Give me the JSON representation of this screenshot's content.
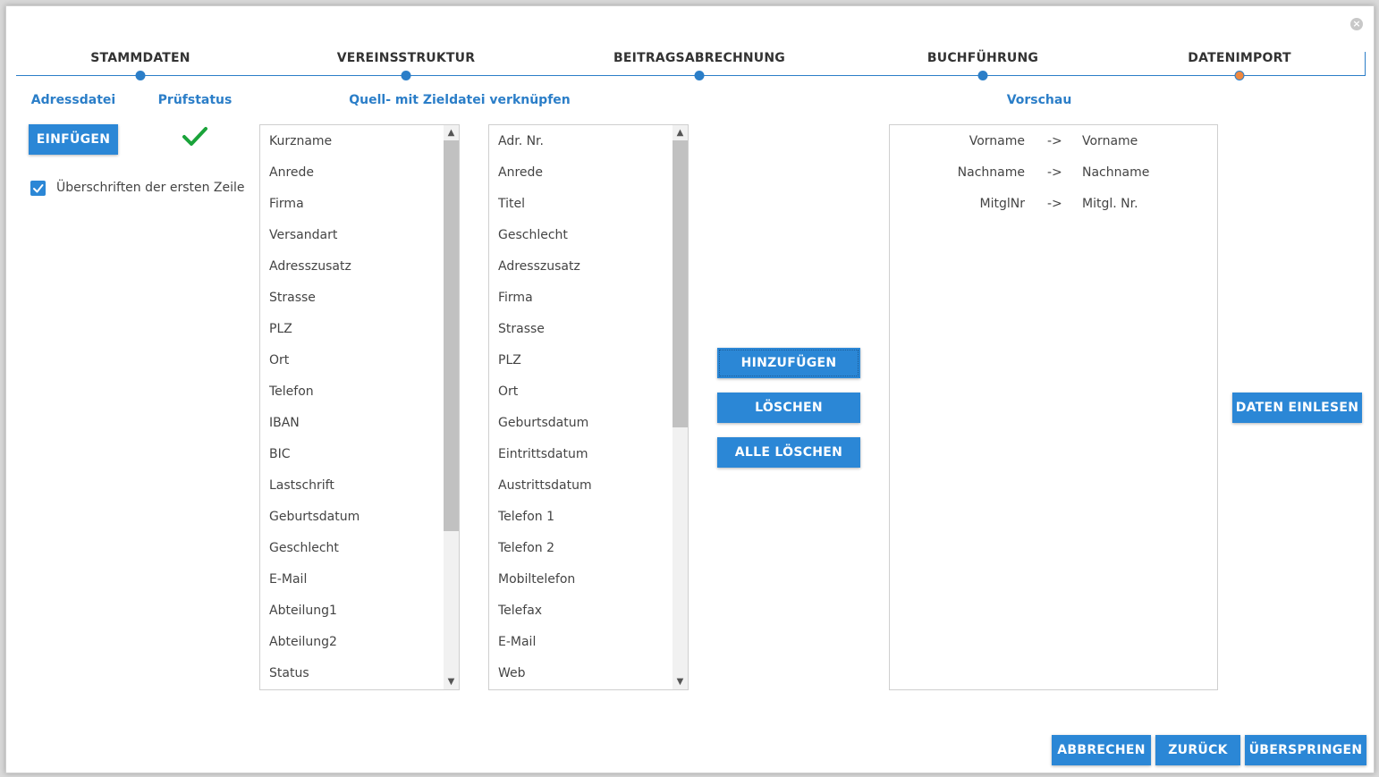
{
  "stepper": {
    "steps": [
      {
        "label": "STAMMDATEN"
      },
      {
        "label": "VEREINSSTRUKTUR"
      },
      {
        "label": "BEITRAGSABRECHNUNG"
      },
      {
        "label": "BUCHFÜHRUNG"
      },
      {
        "label": "DATENIMPORT",
        "active": true
      }
    ]
  },
  "sections": {
    "adressdatei": "Adressdatei",
    "pruefstatus": "Prüfstatus",
    "verknuepfen": "Quell- mit Zieldatei verknüpfen",
    "vorschau": "Vorschau"
  },
  "buttons": {
    "einfuegen": "EINFÜGEN",
    "hinzufuegen": "HINZUFÜGEN",
    "loeschen": "LÖSCHEN",
    "alle_loeschen": "ALLE LÖSCHEN",
    "daten_einlesen": "DATEN EINLESEN",
    "abbrechen": "ABBRECHEN",
    "zurueck": "ZURÜCK",
    "ueberspringen": "ÜBERSPRINGEN"
  },
  "checkbox": {
    "label": "Überschriften der ersten Zeile",
    "checked": true
  },
  "source_list": [
    "Kurzname",
    "Anrede",
    "Firma",
    "Versandart",
    "Adresszusatz",
    "Strasse",
    "PLZ",
    "Ort",
    "Telefon",
    "IBAN",
    "BIC",
    "Lastschrift",
    "Geburtsdatum",
    "Geschlecht",
    "E-Mail",
    "Abteilung1",
    "Abteilung2",
    "Status"
  ],
  "target_list": [
    "Adr. Nr.",
    "Anrede",
    "Titel",
    "Geschlecht",
    "Adresszusatz",
    "Firma",
    "Strasse",
    "PLZ",
    "Ort",
    "Geburtsdatum",
    "Eintrittsdatum",
    "Austrittsdatum",
    "Telefon 1",
    "Telefon 2",
    "Mobiltelefon",
    "Telefax",
    "E-Mail",
    "Web"
  ],
  "preview": [
    {
      "source": "Vorname",
      "arrow": "->",
      "target": "Vorname"
    },
    {
      "source": "Nachname",
      "arrow": "->",
      "target": "Nachname"
    },
    {
      "source": "MitglNr",
      "arrow": "->",
      "target": "Mitgl. Nr."
    }
  ],
  "colors": {
    "accent": "#2b87d6",
    "active_step": "#f0883e",
    "check": "#1aa33a"
  },
  "icons": {
    "close": "close-icon",
    "check": "check-icon",
    "checkbox": "checkbox-checked-icon"
  }
}
